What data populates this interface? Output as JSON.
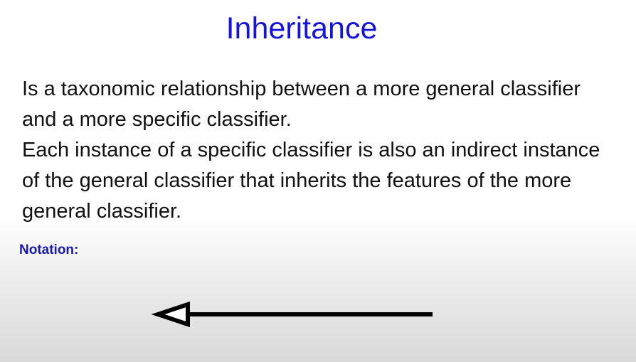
{
  "slide": {
    "title": "Inheritance",
    "paragraphs": [
      "Is a taxonomic relationship between a more general classifier and a more specific classifier.",
      "Each instance of a specific classifier is also an indirect instance of the general classifier that inherits the features of the more general classifier."
    ],
    "notation_label": "Notation:",
    "notation_icon": "inheritance-hollow-triangle-arrow-icon"
  },
  "colors": {
    "title": "#1515d6",
    "body_text": "#111111",
    "notation_label": "#1a1aa8",
    "arrow": "#000000"
  }
}
